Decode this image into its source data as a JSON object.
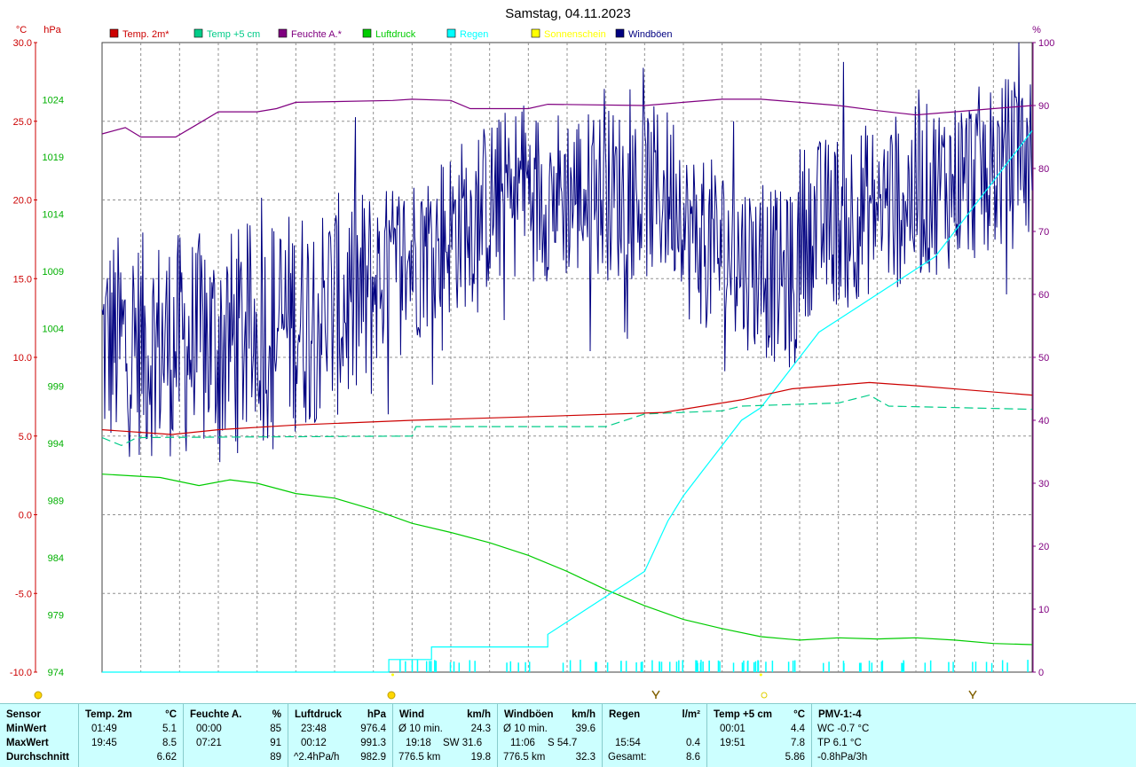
{
  "chart_data": {
    "type": "line",
    "title": "Samstag, 04.11.2023",
    "axes": {
      "temp": {
        "unit": "°C",
        "ticks": [
          "30.0",
          "25.0",
          "20.0",
          "15.0",
          "10.0",
          "5.0",
          "0.0",
          "-5.0",
          "-10.0"
        ],
        "range": [
          -10,
          30
        ]
      },
      "pressure": {
        "unit": "hPa",
        "ticks": [
          "1024",
          "1019",
          "1014",
          "1009",
          "1004",
          "999",
          "994",
          "989",
          "984",
          "979",
          "974"
        ],
        "range": [
          974,
          1029
        ]
      },
      "percent": {
        "unit": "%",
        "ticks": [
          "100",
          "90",
          "80",
          "70",
          "60",
          "50",
          "40",
          "30",
          "20",
          "10",
          "0"
        ],
        "range": [
          0,
          100
        ]
      }
    },
    "time_range_hours": [
      0,
      24
    ],
    "grid": true,
    "legend_position": "top",
    "legend": [
      {
        "label": "Temp. 2m*",
        "color": "#cc0000"
      },
      {
        "label": "Temp +5 cm",
        "color": "#00cc88"
      },
      {
        "label": "Feuchte A.*",
        "color": "#800080"
      },
      {
        "label": "Luftdruck",
        "color": "#00cc00"
      },
      {
        "label": "Regen",
        "color": "#00ffff"
      },
      {
        "label": "Sonnenschein",
        "color": "#ffff00"
      },
      {
        "label": "Windböen",
        "color": "#000080"
      }
    ],
    "series": [
      {
        "name": "Temp. 2m*",
        "axis": "temp",
        "color": "#cc0000",
        "points": [
          [
            0,
            5.4
          ],
          [
            1.8,
            5.1
          ],
          [
            3,
            5.4
          ],
          [
            5,
            5.7
          ],
          [
            8,
            6.0
          ],
          [
            12,
            6.3
          ],
          [
            14.5,
            6.5
          ],
          [
            16.5,
            7.3
          ],
          [
            17.8,
            8.0
          ],
          [
            19.8,
            8.4
          ],
          [
            21,
            8.2
          ],
          [
            22.5,
            7.9
          ],
          [
            24,
            7.6
          ]
        ]
      },
      {
        "name": "Temp +5 cm",
        "axis": "temp",
        "color": "#00cc88",
        "points": [
          [
            0,
            4.9
          ],
          [
            0.5,
            4.4
          ],
          [
            0.9,
            4.9
          ],
          [
            8,
            5.0
          ],
          [
            8.1,
            5.6
          ],
          [
            13,
            5.6
          ],
          [
            14,
            6.4
          ],
          [
            16,
            6.6
          ],
          [
            16.5,
            6.9
          ],
          [
            19,
            7.1
          ],
          [
            19.8,
            7.6
          ],
          [
            20.3,
            6.9
          ],
          [
            24,
            6.7
          ]
        ]
      },
      {
        "name": "Feuchte A.*",
        "axis": "percent",
        "color": "#800080",
        "points": [
          [
            0,
            85.5
          ],
          [
            0.6,
            86.5
          ],
          [
            1,
            85
          ],
          [
            1.9,
            85
          ],
          [
            2.4,
            86.8
          ],
          [
            3,
            89
          ],
          [
            4,
            89
          ],
          [
            4.5,
            89.5
          ],
          [
            5,
            90.5
          ],
          [
            7.5,
            90.8
          ],
          [
            8,
            91
          ],
          [
            9,
            90.8
          ],
          [
            9.5,
            89.5
          ],
          [
            11,
            89.5
          ],
          [
            11.5,
            90.2
          ],
          [
            14,
            90
          ],
          [
            15,
            90.5
          ],
          [
            16,
            91
          ],
          [
            17,
            91
          ],
          [
            18,
            90.5
          ],
          [
            19,
            90
          ],
          [
            20,
            89.2
          ],
          [
            21,
            88.5
          ],
          [
            22,
            89
          ],
          [
            23,
            89.5
          ],
          [
            24,
            90
          ]
        ]
      },
      {
        "name": "Luftdruck",
        "axis": "pressure",
        "points": [
          [
            0,
            991.3
          ],
          [
            1.5,
            991.0
          ],
          [
            2.5,
            990.3
          ],
          [
            3.3,
            990.8
          ],
          [
            4,
            990.5
          ],
          [
            5,
            989.6
          ],
          [
            6,
            989.2
          ],
          [
            7,
            988.2
          ],
          [
            8,
            987.0
          ],
          [
            9,
            986.2
          ],
          [
            10,
            985.3
          ],
          [
            11,
            984.2
          ],
          [
            12,
            982.8
          ],
          [
            13,
            981.2
          ],
          [
            14,
            979.8
          ],
          [
            15,
            978.6
          ],
          [
            16,
            977.8
          ],
          [
            17,
            977.1
          ],
          [
            18,
            976.8
          ],
          [
            19,
            977.0
          ],
          [
            20,
            976.9
          ],
          [
            21,
            977.0
          ],
          [
            22,
            976.8
          ],
          [
            23,
            976.5
          ],
          [
            24,
            976.4
          ]
        ]
      },
      {
        "name": "Regen",
        "axis": "percent",
        "color": "#00ffff",
        "points": [
          [
            0,
            0
          ],
          [
            7.4,
            0
          ],
          [
            7.4,
            2
          ],
          [
            8.5,
            2
          ],
          [
            8.5,
            4
          ],
          [
            10.5,
            4
          ],
          [
            11.5,
            4
          ],
          [
            11.5,
            6
          ],
          [
            12,
            8
          ],
          [
            12.5,
            10
          ],
          [
            13,
            12
          ],
          [
            13.5,
            14
          ],
          [
            14,
            16
          ],
          [
            14.3,
            20
          ],
          [
            14.6,
            24
          ],
          [
            15,
            28
          ],
          [
            15.5,
            32
          ],
          [
            16,
            36
          ],
          [
            16.5,
            40
          ],
          [
            17,
            42
          ],
          [
            17.5,
            46
          ],
          [
            18,
            50
          ],
          [
            18.5,
            54
          ],
          [
            19,
            56
          ],
          [
            19.5,
            58
          ],
          [
            20,
            60
          ],
          [
            20.5,
            62
          ],
          [
            21,
            64
          ],
          [
            21.5,
            66
          ],
          [
            22,
            70
          ],
          [
            22.5,
            74
          ],
          [
            23,
            78
          ],
          [
            23.5,
            82
          ],
          [
            24,
            86
          ]
        ]
      },
      {
        "name": "Windböen",
        "axis": "percent",
        "color": "#000080",
        "scale": "gust",
        "points": []
      }
    ],
    "sunshine_markers_hours": [
      7.5,
      17.0
    ]
  },
  "statistics": {
    "columns": [
      {
        "header": "Sensor",
        "unit": "",
        "rows": [
          {
            "label": "MinWert"
          },
          {
            "label": "MaxWert"
          },
          {
            "label": "Durchschnitt"
          }
        ]
      },
      {
        "header": "Temp. 2m",
        "unit": "°C",
        "rows": [
          {
            "time": "01:49",
            "value": "5.1"
          },
          {
            "time": "19:45",
            "value": "8.5"
          },
          {
            "time": "",
            "value": "6.62"
          }
        ]
      },
      {
        "header": "Feuchte A.",
        "unit": "%",
        "rows": [
          {
            "time": "00:00",
            "value": "85"
          },
          {
            "time": "07:21",
            "value": "91"
          },
          {
            "time": "",
            "value": "89"
          }
        ]
      },
      {
        "header": "Luftdruck",
        "unit": "hPa",
        "rows": [
          {
            "time": "23:48",
            "value": "976.4"
          },
          {
            "time": "00:12",
            "value": "991.3"
          },
          {
            "time": "^2.4hPa/h",
            "value": "982.9"
          }
        ]
      },
      {
        "header": "Wind",
        "unit": "km/h",
        "rows": [
          {
            "time": "Ø 10 min.",
            "value": "24.3"
          },
          {
            "time": "19:18",
            "mid": "SW 31.6",
            "value": ""
          },
          {
            "time": "776.5 km",
            "value": "19.8"
          }
        ]
      },
      {
        "header": "Windböen",
        "unit": "km/h",
        "rows": [
          {
            "time": "Ø 10 min.",
            "value": "39.6"
          },
          {
            "time": "11:06",
            "mid": "S 54.7",
            "value": ""
          },
          {
            "time": "776.5 km",
            "value": "32.3"
          }
        ]
      },
      {
        "header": "Regen",
        "unit": "l/m²",
        "rows": [
          {
            "time": "",
            "value": ""
          },
          {
            "time": "15:54",
            "value": "0.4"
          },
          {
            "time": "Gesamt:",
            "value": "8.6"
          }
        ]
      },
      {
        "header": "Temp +5 cm",
        "unit": "°C",
        "rows": [
          {
            "time": "00:01",
            "value": "4.4"
          },
          {
            "time": "19:51",
            "value": "7.8"
          },
          {
            "time": "",
            "value": "5.86"
          }
        ]
      },
      {
        "header": "PMV-1:-4",
        "unit": "",
        "rows": [
          {
            "time": "WC -0.7 °C",
            "value": ""
          },
          {
            "time": "TP 6.1 °C",
            "value": ""
          },
          {
            "time": "-0.8hPa/3h",
            "value": ""
          }
        ]
      }
    ]
  }
}
